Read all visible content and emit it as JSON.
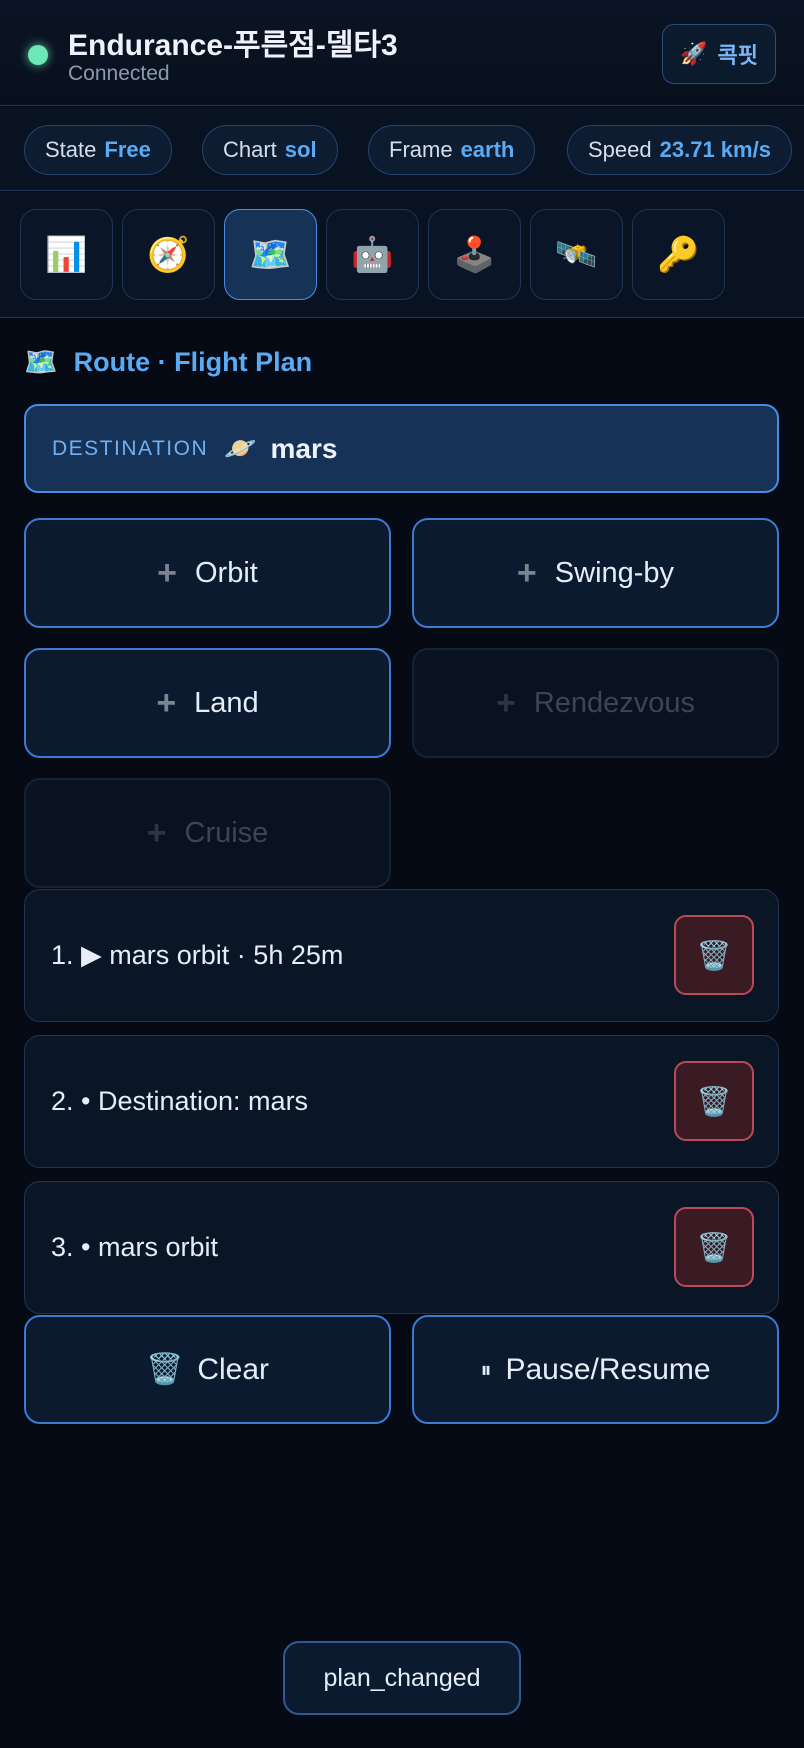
{
  "header": {
    "ship_name": "Endurance-푸른점-델타3",
    "connection": "Connected",
    "cockpit_label": "콕핏",
    "cockpit_icon": "🚀"
  },
  "status_chips": [
    {
      "label": "State",
      "value": "Free"
    },
    {
      "label": "Chart",
      "value": "sol"
    },
    {
      "label": "Frame",
      "value": "earth"
    },
    {
      "label": "Speed",
      "value": "23.71 km/s"
    }
  ],
  "toolbar": [
    {
      "icon": "📊",
      "name": "stats"
    },
    {
      "icon": "🧭",
      "name": "compass"
    },
    {
      "icon": "🗺️",
      "name": "map",
      "active": true
    },
    {
      "icon": "🤖",
      "name": "robot"
    },
    {
      "icon": "🕹️",
      "name": "joystick"
    },
    {
      "icon": "🛰️",
      "name": "satellite"
    },
    {
      "icon": "🔑",
      "name": "key"
    }
  ],
  "section": {
    "icon": "🗺️",
    "title": "Route · Flight Plan"
  },
  "destination": {
    "label": "DESTINATION",
    "icon": "🪐",
    "value": "mars"
  },
  "actions": [
    {
      "plus": "+",
      "label": "Orbit",
      "enabled": true
    },
    {
      "plus": "+",
      "label": "Swing-by",
      "enabled": true
    },
    {
      "plus": "+",
      "label": "Land",
      "enabled": true
    },
    {
      "plus": "+",
      "label": "Rendezvous",
      "enabled": false
    },
    {
      "plus": "+",
      "label": "Cruise",
      "enabled": false
    }
  ],
  "plan": [
    {
      "text": "1. ▶ mars orbit · 5h 25m",
      "delete_icon": "🗑️"
    },
    {
      "text": "2. • Destination: mars",
      "delete_icon": "🗑️"
    },
    {
      "text": "3. • mars orbit",
      "delete_icon": "🗑️"
    }
  ],
  "controls": {
    "clear_icon": "🗑️",
    "clear_label": "Clear",
    "pause_icon": "⏸",
    "pause_label": "Pause/Resume"
  },
  "toast": "plan_changed"
}
